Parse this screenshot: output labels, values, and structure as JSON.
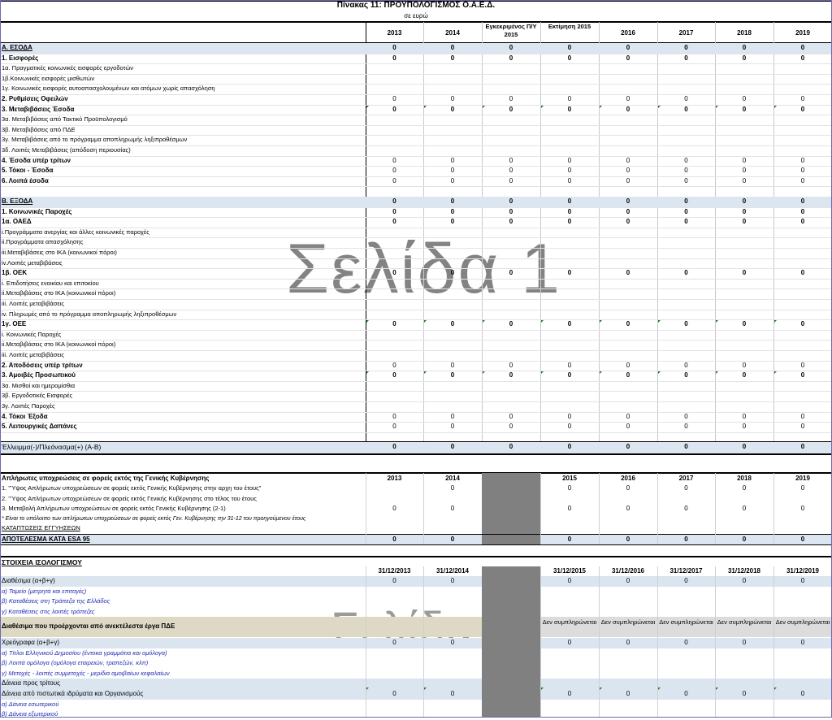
{
  "title": "Πίνακας 11:  ΠΡΟΫΠΟΛΟΓΙΣΜΟΣ Ο.Α.Ε.Δ.",
  "subtitle": "σε ευρώ",
  "columns": [
    "2013",
    "2014",
    "Εγκεκριμένος Π/Υ 2015",
    "Εκτίμηση 2015",
    "2016",
    "2017",
    "2018",
    "2019"
  ],
  "watermark1": "Σελίδα 1",
  "watermark2": "Σελίδα 2",
  "rows": [
    {
      "label": "Α. ΕΣΟΔΑ",
      "bold": true,
      "shade": true,
      "underline": true,
      "values": [
        "0",
        "0",
        "0",
        "0",
        "0",
        "0",
        "0",
        "0"
      ]
    },
    {
      "label": "1. Εισφορές",
      "bold": true,
      "values": [
        "0",
        "0",
        "0",
        "0",
        "0",
        "0",
        "0",
        "0"
      ]
    },
    {
      "label": "     1α. Πραγματικές κοινωνικές εισφορές εργοδοτών",
      "values": []
    },
    {
      "label": "     1β.Κοινωνικές εισφορές μισθωτών",
      "values": []
    },
    {
      "label": "     1γ. Κοινωνικές εισφορές αυτοαπασχολουμένων και ατόμων χωρίς απασχόληση",
      "values": []
    },
    {
      "label": "2. Ρυθμίσεις Οφειλών",
      "bold": true,
      "values": [
        "0",
        "0",
        "0",
        "0",
        "0",
        "0",
        "0",
        "0"
      ],
      "light": true
    },
    {
      "label": "3. Μεταβιβάσεις Έσοδα",
      "bold": true,
      "values": [
        "0",
        "0",
        "0",
        "0",
        "0",
        "0",
        "0",
        "0"
      ],
      "marks": true
    },
    {
      "label": "     3α. Μεταβιβάσεις από Τακτικό Προϋπολογισμό",
      "values": []
    },
    {
      "label": "     3β. Μεταβιβάσεις από ΠΔΕ",
      "values": []
    },
    {
      "label": "     3γ. Μεταβιβάσεις από το πρόγραμμα αποπληρωμής ληξιπροθέσμων",
      "values": []
    },
    {
      "label": "     3δ. Λοιπές Μεταβιβάσεις (απόδοση περιουσίας)",
      "values": []
    },
    {
      "label": "4. Έσοδα υπέρ τρίτων",
      "bold": true,
      "values": [
        "0",
        "0",
        "0",
        "0",
        "0",
        "0",
        "0",
        "0"
      ],
      "light": true
    },
    {
      "label": "5. Τόκοι - Έσοδα",
      "bold": true,
      "values": [
        "0",
        "0",
        "0",
        "0",
        "0",
        "0",
        "0",
        "0"
      ],
      "light": true
    },
    {
      "label": "6. Λοιπά έσοδα",
      "bold": true,
      "values": [
        "0",
        "0",
        "0",
        "0",
        "0",
        "0",
        "0",
        "0"
      ],
      "light": true
    },
    {
      "label": "",
      "values": []
    },
    {
      "label": "Β. ΕΞΟΔΑ",
      "bold": true,
      "shade": true,
      "underline": true,
      "values": [
        "0",
        "0",
        "0",
        "0",
        "0",
        "0",
        "0",
        "0"
      ]
    },
    {
      "label": "1. Κοινωνικές Παροχές",
      "bold": true,
      "values": [
        "0",
        "0",
        "0",
        "0",
        "0",
        "0",
        "0",
        "0"
      ]
    },
    {
      "label": "   1α. ΟΑΕΔ",
      "bold": true,
      "values": [
        "0",
        "0",
        "0",
        "0",
        "0",
        "0",
        "0",
        "0"
      ]
    },
    {
      "label": "        i.Προγράμματα ανεργίας και άλλες κοινωνικές παροχές",
      "values": []
    },
    {
      "label": "        ii.Προγράμματα απασχόλησης",
      "values": []
    },
    {
      "label": "        iii.Μεταβιβάσεις στο ΙΚΑ (κοινωνικοί πόροι)",
      "values": []
    },
    {
      "label": "        iv.Λοιπές μεταβιβάσεις",
      "values": []
    },
    {
      "label": "   1β. ΟΕΚ",
      "bold": true,
      "values": [
        "0",
        "0",
        "0",
        "0",
        "0",
        "0",
        "0",
        "0"
      ]
    },
    {
      "label": "        i. Επιδοτήσεις ενοικίου  και επιτοκίου",
      "values": []
    },
    {
      "label": "        ii.Μεταβιβάσεις στο ΙΚΑ  (κοινωνικοί πόροι)",
      "values": []
    },
    {
      "label": "        iii. Λοιπές μεταβιβάσεις",
      "values": []
    },
    {
      "label": "        iv. Πληρωμές από το πρόγραμμα αποπληρωμής ληξιπροθέσμων",
      "values": []
    },
    {
      "label": "   1γ. ΟΕΕ",
      "bold": true,
      "values": [
        "0",
        "0",
        "0",
        "0",
        "0",
        "0",
        "0",
        "0"
      ],
      "marks": true
    },
    {
      "label": "        i. Κοινωνικές Παροχές",
      "values": []
    },
    {
      "label": "        ii.Μεταβιβάσεις στο ΙΚΑ (κοινωνικοί πόροι)",
      "values": []
    },
    {
      "label": "        iii. Λοιπές μεταβιβάσεις",
      "values": []
    },
    {
      "label": "2. Αποδόσεις υπέρ τρίτων",
      "bold": true,
      "values": [
        "0",
        "0",
        "0",
        "0",
        "0",
        "0",
        "0",
        "0"
      ],
      "light": true
    },
    {
      "label": "3. Αμοιβές Προσωπικού",
      "bold": true,
      "values": [
        "0",
        "0",
        "0",
        "0",
        "0",
        "0",
        "0",
        "0"
      ],
      "marks": true
    },
    {
      "label": "     3α. Μισθοί και ημερομίσθια",
      "values": []
    },
    {
      "label": "     3β. Εργοδοτικές Εισφορές",
      "values": []
    },
    {
      "label": "     3γ. Λοιπές Παροχές",
      "values": []
    },
    {
      "label": "4. Τόκοι Έξοδα",
      "bold": true,
      "values": [
        "0",
        "0",
        "0",
        "0",
        "0",
        "0",
        "0",
        "0"
      ],
      "light": true
    },
    {
      "label": "5. Λειτουργικές Δαπάνες",
      "bold": true,
      "values": [
        "0",
        "0",
        "0",
        "0",
        "0",
        "0",
        "0",
        "0"
      ],
      "light": true
    },
    {
      "label": "",
      "values": []
    },
    {
      "label": "Έλλειμμα(-)/Πλεόνασμα(+) (Α-Β)",
      "bold": false,
      "shade": true,
      "values": [
        "0",
        "0",
        "0",
        "0",
        "0",
        "0",
        "0",
        "0"
      ],
      "boldvals": true
    }
  ],
  "arrears": {
    "heading": "Απλήρωτες υποχρεώσεις σε φορείς εκτός της Γενικής Κυβέρνησης",
    "columns": [
      "2013",
      "2014",
      "2015",
      "2016",
      "2017",
      "2018",
      "2019"
    ],
    "rows": [
      {
        "label": "1. \"Ύψος Απλήρωτων υποχρεώσεων σε φορείς εκτός Γενικής Κυβέρνησης στην αρχη του έτους\"",
        "values": [
          "",
          "0",
          "0",
          "0",
          "0",
          "0",
          "0"
        ]
      },
      {
        "label": "2. \"Ύψος Απλήρωτων υποχρεώσεων σε φορείς εκτός Γενικής Κυβέρνησης στο τέλος του έτους",
        "values": [
          "",
          "",
          "",
          "",
          "",
          "",
          ""
        ]
      },
      {
        "label": "3. Μεταβολή Απλήρωτων υποχρεώσεων σε φορείς εκτός Γενικής Κυβέρνησης (2-1)",
        "values": [
          "0",
          "0",
          "0",
          "0",
          "0",
          "0",
          "0"
        ]
      }
    ],
    "note": "* Είναι το υπόλοιπο των απλήρωτων υποχρεώσεων σε φορείς εκτός Γεν. Κυβέρνησης την 31-12 του προηγούμενου έτους",
    "guarantees": "ΚΑΤΑΠΤΩΣΕΙΣ ΕΓΓΥΗΣΕΩΝ",
    "esa_label": "ΑΠΟΤΕΛΕΣΜΑ ΚΑΤΑ ESA 95",
    "esa_values": [
      "0",
      "0",
      "0",
      "0",
      "0",
      "0",
      "0"
    ]
  },
  "balance": {
    "heading": "ΣΤΟΙΧΕΙΑ ΙΣΟΛΟΓΙΣΜΟΥ",
    "columns": [
      "31/12/2013",
      "31/12/2014",
      "31/12/2015",
      "31/12/2016",
      "31/12/2017",
      "31/12/2018",
      "31/12/2019"
    ],
    "rows": [
      {
        "label": "Διαθέσιμα (α+β+γ)",
        "shade": true,
        "values": [
          "0",
          "0",
          "0",
          "0",
          "0",
          "0",
          "0"
        ]
      },
      {
        "label": "α) Ταμείο (μετρητά και επιταγές)",
        "blue": true,
        "values": []
      },
      {
        "label": "β) Καταθέσεις στη Τράπεζα της Ελλάδος",
        "blue": true,
        "values": []
      },
      {
        "label": "γ) Καταθέσεις στις λοιπές τράπεζες",
        "blue": true,
        "values": []
      },
      {
        "label": "Διαθέσιμα που προέρχονται από ανεκτέλεστα έργα ΠΔΕ",
        "bold": true,
        "tan": true,
        "values": [],
        "nmv": "Δεν συμπληρώνεται"
      },
      {
        "label": "Χρεόγραφα (α+β+γ)",
        "shade": true,
        "values": [
          "0",
          "0",
          "0",
          "0",
          "0",
          "0",
          "0"
        ]
      },
      {
        "label": "α) Τίτλοι Ελληνικού Δημοσίου (έντοκα γραμμάτια και ομόλογα)",
        "blue": true,
        "values": []
      },
      {
        "label": "β) Λοιπά ομόλογα (ομόλογα εταιρειών, τραπεζών, κλπ)",
        "blue": true,
        "values": []
      },
      {
        "label": "γ) Μετοχές - λοιπές συμμετοχές - μερίδια αμοιβαίων κεφαλαίων",
        "blue": true,
        "values": []
      },
      {
        "label": "Δάνεια προς τρίτους",
        "shade": true,
        "values": []
      },
      {
        "label": "Δάνεια από πιστωτικά ιδρύματα και Οργανισμούς",
        "shade": true,
        "values": [
          "0",
          "0",
          "0",
          "0",
          "0",
          "0",
          "0"
        ],
        "marks": true
      },
      {
        "label": "α) Δάνεια εσωτερικού",
        "blue": true,
        "values": []
      },
      {
        "label": "β) Δάνεια εξωτερικού",
        "blue": true,
        "values": []
      }
    ]
  }
}
